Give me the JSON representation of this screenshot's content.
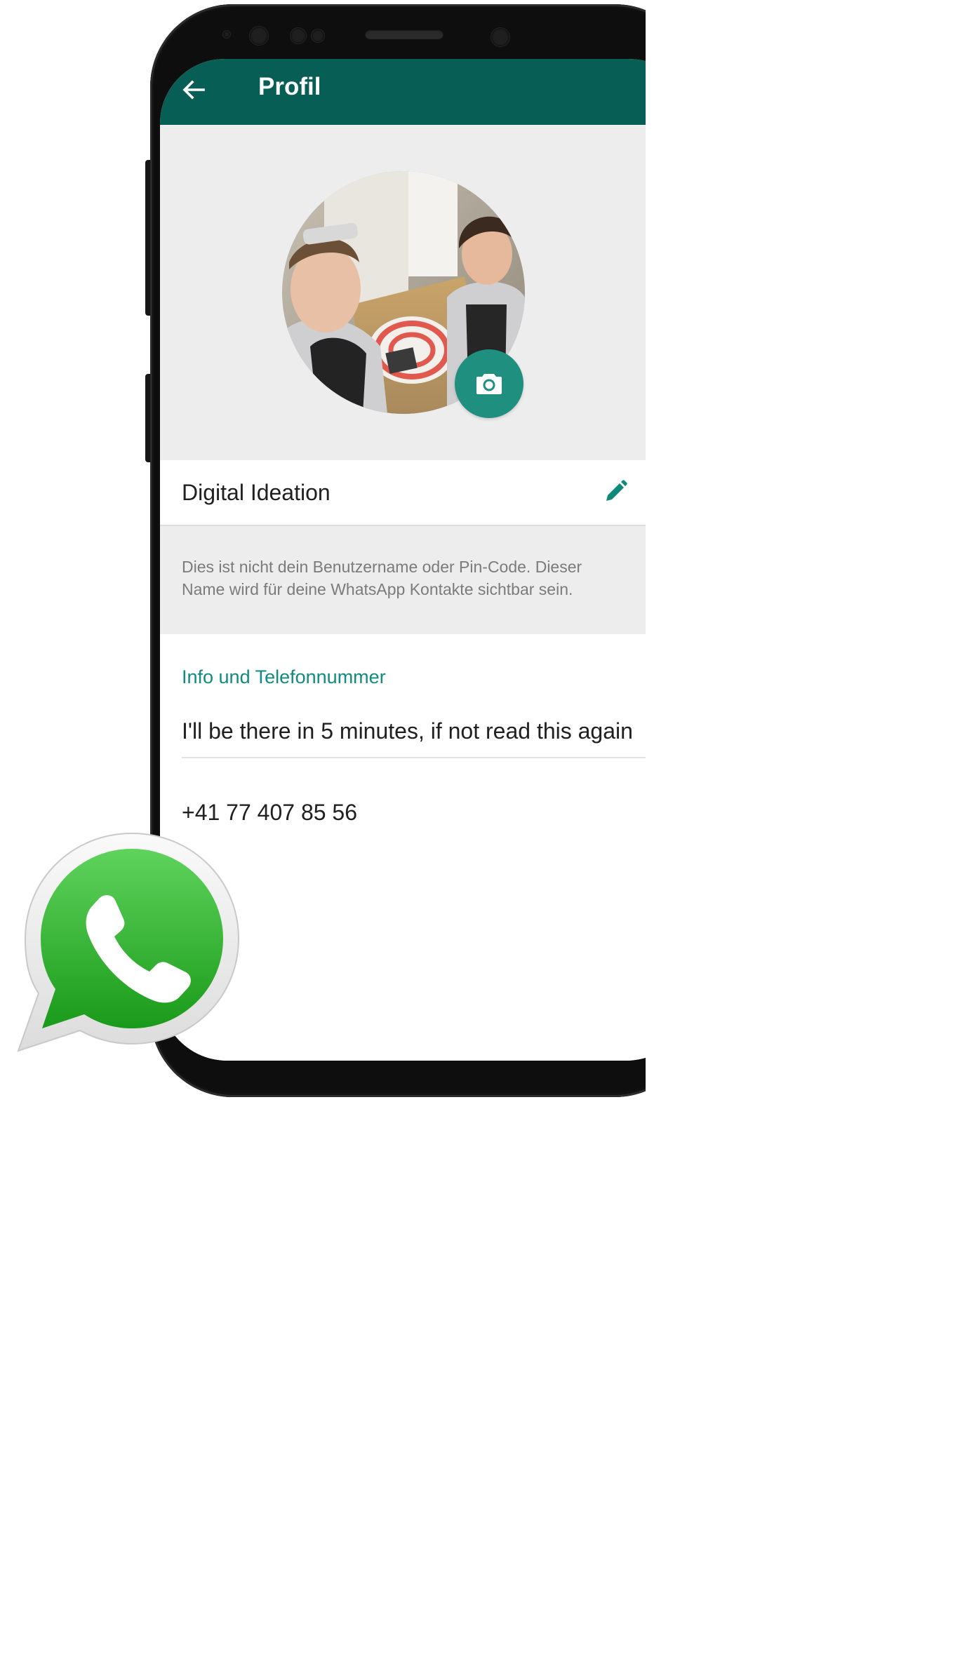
{
  "header": {
    "title": "Profil"
  },
  "profile": {
    "name": "Digital Ideation",
    "name_hint": "Dies ist nicht dein Benutzername oder Pin-Code. Dieser Name wird für deine WhatsApp Kontakte sichtbar sein.",
    "info_heading": "Info und Telefonnummer",
    "about": "I'll be there in 5 minutes, if not read this again",
    "phone": "+41 77 407 85 56"
  },
  "icons": {
    "back": "arrow-left-icon",
    "camera": "camera-icon",
    "edit": "pencil-icon",
    "logo": "whatsapp-logo-icon"
  },
  "colors": {
    "header_bg": "#075e54",
    "accent": "#118c7e",
    "camera_button": "#1f8f7f",
    "section_bg": "#ededed",
    "logo_green": "#2fb62f"
  }
}
